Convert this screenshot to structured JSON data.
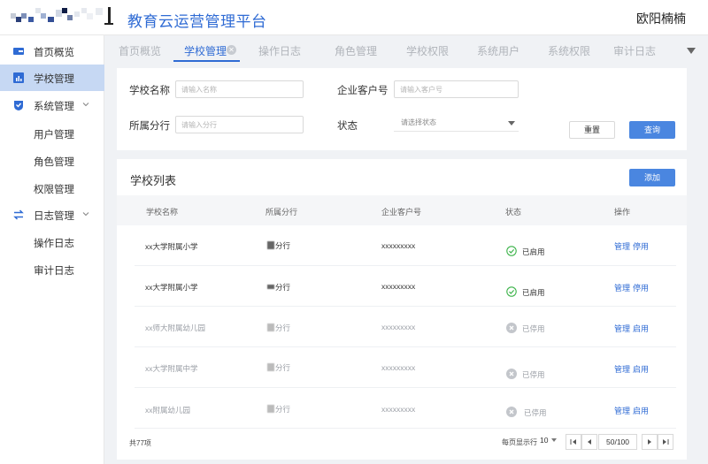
{
  "header": {
    "app_title": "教育云运营管理平台",
    "user_name": "欧阳楠楠"
  },
  "sidebar": {
    "items": [
      {
        "label": "首页概览",
        "icon": "dashboard-icon"
      },
      {
        "label": "学校管理",
        "icon": "chart-icon",
        "active": true
      },
      {
        "label": "系统管理",
        "icon": "shield-icon",
        "expandable": true
      },
      {
        "label": "用户管理"
      },
      {
        "label": "角色管理"
      },
      {
        "label": "权限管理"
      },
      {
        "label": "日志管理",
        "icon": "transfer-icon",
        "expandable": true
      },
      {
        "label": "操作日志"
      },
      {
        "label": "审计日志"
      }
    ]
  },
  "tabs": [
    {
      "label": "首页概览"
    },
    {
      "label": "学校管理",
      "active": true
    },
    {
      "label": "操作日志"
    },
    {
      "label": "角色管理"
    },
    {
      "label": "学校权限"
    },
    {
      "label": "系统用户"
    },
    {
      "label": "系统权限"
    },
    {
      "label": "审计日志"
    }
  ],
  "filters": {
    "school_name_label": "学校名称",
    "school_name_placeholder": "请输入名称",
    "customer_no_label": "企业客户号",
    "customer_no_placeholder": "请输入客户号",
    "branch_label": "所属分行",
    "branch_placeholder": "请输入分行",
    "status_label": "状态",
    "status_placeholder": "请选择状态",
    "reset_label": "重置",
    "search_label": "查询"
  },
  "list": {
    "title": "学校列表",
    "add_label": "添加",
    "columns": [
      "学校名称",
      "所属分行",
      "企业客户号",
      "状态",
      "操作"
    ],
    "rows": [
      {
        "name": "xx大学附属小学",
        "branch": "分行",
        "customer_no": "xxxxxxxxx",
        "status": "已启用",
        "enabled": true,
        "action_manage": "管理",
        "action_toggle": "停用"
      },
      {
        "name": "xx大学附属小学",
        "branch": "分行",
        "customer_no": "xxxxxxxxx",
        "status": "已启用",
        "enabled": true,
        "action_manage": "管理",
        "action_toggle": "停用"
      },
      {
        "name": "xx师大附属幼儿园",
        "branch": "分行",
        "customer_no": "xxxxxxxxx",
        "status": "已停用",
        "enabled": false,
        "action_manage": "管理",
        "action_toggle": "启用"
      },
      {
        "name": "xx大学附属中学",
        "branch": "分行",
        "customer_no": "xxxxxxxxx",
        "status": "已停用",
        "enabled": false,
        "action_manage": "管理",
        "action_toggle": "启用"
      },
      {
        "name": "xx附属幼儿园",
        "branch": "分行",
        "customer_no": "xxxxxxxxx",
        "status": "已停用",
        "enabled": false,
        "action_manage": "管理",
        "action_toggle": "启用"
      }
    ]
  },
  "pagination": {
    "total": "共77项",
    "page_size_label": "每页显示行",
    "page_size": "10",
    "page_info": "50/100"
  },
  "colors": {
    "primary": "#2f6bd4",
    "button_primary": "#4a86e0",
    "enabled_green": "#3cb34a",
    "disabled_gray": "#c3c6cb",
    "sidebar_active": "#c6d8f3"
  }
}
